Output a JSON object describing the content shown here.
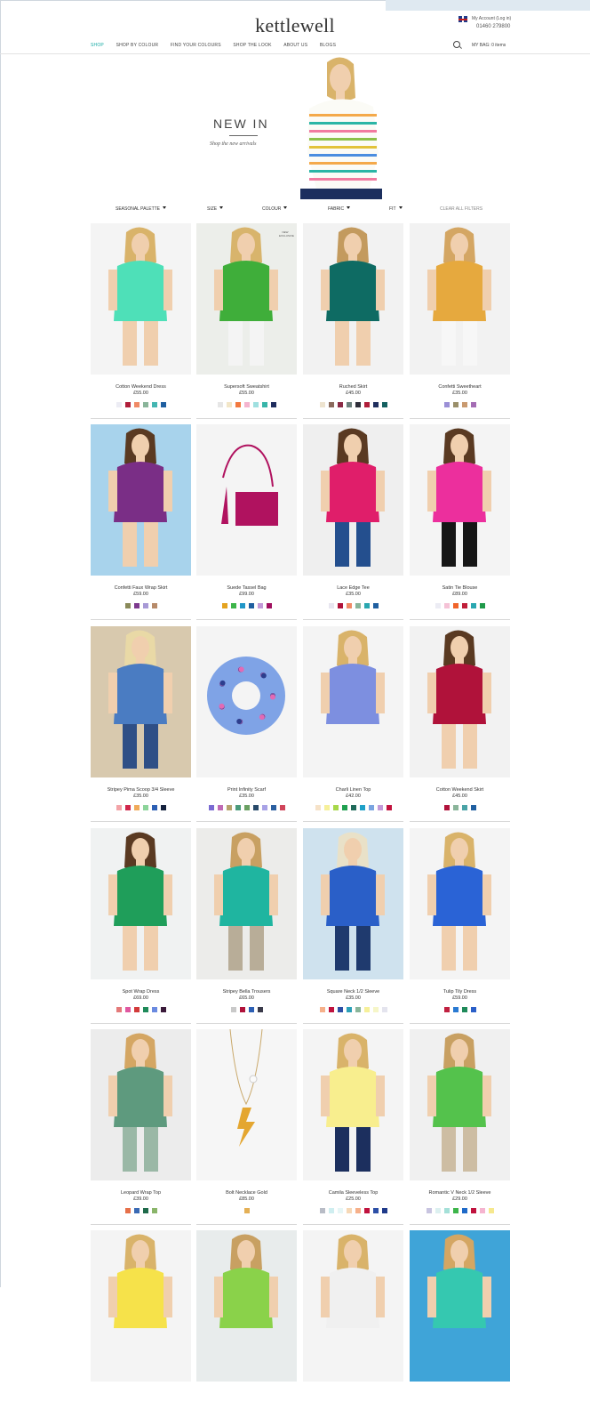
{
  "brand": {
    "logo": "kettlewell"
  },
  "account": {
    "login_text": "My Account (Log in)",
    "phone": "01460 279800"
  },
  "nav": {
    "items": [
      "SHOP",
      "SHOP BY COLOUR",
      "FIND YOUR COLOURS",
      "SHOP THE LOOK",
      "ABOUT US",
      "BLOGS"
    ],
    "bag": "MY BAG: 0 items"
  },
  "hero": {
    "title": "NEW IN",
    "subtitle": "Shop the new arrivals"
  },
  "filters": {
    "items": [
      "SEASONAL PALETTE",
      "SIZE",
      "COLOUR",
      "FABRIC",
      "FIT"
    ],
    "clear": "CLEAR ALL FILTERS"
  },
  "badge": "NEW EXCLUSIVE",
  "products": [
    {
      "name": "Cotton Weekend Dress",
      "price": "£55.00",
      "bg": "#f4f4f4",
      "main": "#4ee0b8",
      "skin": "#f0cfae",
      "hair": "#d9b36a",
      "legs": "#f0cfae",
      "swatches": [
        "#ececf4",
        "#b01e3a",
        "#f08a66",
        "#8ab59a",
        "#45b6b2",
        "#1f5fa0"
      ]
    },
    {
      "name": "Supersoft Sweatshirt",
      "price": "£55.00",
      "bg": "#eceeea",
      "main": "#3fae3a",
      "skin": "#f0cfae",
      "hair": "#d8b46c",
      "legs": "#f4f4f4",
      "swatches": [
        "#e6e6e6",
        "#f2e6c8",
        "#f2793f",
        "#f5b4cf",
        "#9fe0e0",
        "#38b5a9",
        "#1f2d5e"
      ]
    },
    {
      "name": "Ruched Skirt",
      "price": "£45.00",
      "bg": "#f2f2f2",
      "main": "#0e6b63",
      "skin": "#f0cfae",
      "hair": "#c39a5e",
      "legs": "#f0cfae",
      "swatches": [
        "#ede3cf",
        "#8a6a5c",
        "#8a2a45",
        "#6b7f7b",
        "#2f2f3a",
        "#b01e3a",
        "#1f2f5e",
        "#146060"
      ]
    },
    {
      "name": "Confetti Sweetheart",
      "price": "£35.00",
      "bg": "#f2f2f2",
      "main": "#e6a93e",
      "skin": "#f0cfae",
      "hair": "#d4a663",
      "legs": "#f7f7f7",
      "swatches": [
        "#9b8fd6",
        "#9a8f6a",
        "#c99a70",
        "#a46cb4"
      ]
    },
    {
      "name": "Confetti Faux Wrap Skirt",
      "price": "£59.00",
      "bg": "#a8d3ec",
      "main": "#7a2e86",
      "skin": "#f0cfae",
      "hair": "#5a3a22",
      "legs": "#f0cfae",
      "swatches": [
        "#8a8a5a",
        "#7d3a8e",
        "#a89ad6",
        "#b78b6a"
      ]
    },
    {
      "name": "Suede Tassel Bag",
      "price": "£99.00",
      "bg": "#f4f4f4",
      "main": "#b0125f",
      "skin": "#f4f4f4",
      "hair": "#f4f4f4",
      "legs": "#f4f4f4",
      "swatches": [
        "#e4a31f",
        "#3db54a",
        "#2096c8",
        "#1f5fa0",
        "#c39ad8",
        "#a01060"
      ]
    },
    {
      "name": "Lace Edge Tee",
      "price": "£35.00",
      "bg": "#efefef",
      "main": "#e01e6a",
      "skin": "#f0cfae",
      "hair": "#5a3a22",
      "legs": "#244f8e",
      "swatches": [
        "#e8e6f0",
        "#b0123a",
        "#f08a66",
        "#8ab59a",
        "#2aa7b0",
        "#1f5fa0"
      ]
    },
    {
      "name": "Satin Tie Blouse",
      "price": "£89.00",
      "bg": "#f4f4f4",
      "main": "#ec2f9d",
      "skin": "#f0cfae",
      "hair": "#5a3a22",
      "legs": "#161616",
      "swatches": [
        "#ececf4",
        "#f5c2d6",
        "#f0642a",
        "#c01e3a",
        "#2aa7b0",
        "#1f9a4a"
      ]
    },
    {
      "name": "Stripey Pima Scoop 3/4 Sleeve",
      "price": "£35.00",
      "bg": "#d8c9ae",
      "main": "#4a7cc2",
      "skin": "#f0cfae",
      "hair": "#e9d9a6",
      "legs": "#2f4f86",
      "swatches": [
        "#f3a4a8",
        "#d0264b",
        "#f0aa5a",
        "#8cd49a",
        "#2c5fb4",
        "#14213d"
      ]
    },
    {
      "name": "Print Infinity Scarf",
      "price": "£35.00",
      "bg": "#f4f4f4",
      "main": "#7fa3e6",
      "skin": "#f4f4f4",
      "hair": "#f4f4f4",
      "legs": "#f4f4f4",
      "swatches": [
        "#7a6ad2",
        "#c06ab4",
        "#b7a36e",
        "#4a9a7a",
        "#6aa062",
        "#284a6a",
        "#a8a2e6",
        "#2b5fa0",
        "#d0445a"
      ]
    },
    {
      "name": "Charli Linen Top",
      "price": "£42.00",
      "bg": "#f4f4f4",
      "main": "#7d8fe0",
      "skin": "#f0cfae",
      "hair": "#d9b36a",
      "legs": "#f4f4f4",
      "swatches": [
        "#f6e2c8",
        "#f6f09a",
        "#a7d84a",
        "#20a050",
        "#1f6a5a",
        "#1ea0c8",
        "#7aa4e0",
        "#c39ad8",
        "#c2123e"
      ]
    },
    {
      "name": "Cotton Weekend Skirt",
      "price": "£45.00",
      "bg": "#f2f2f2",
      "main": "#b0123a",
      "skin": "#f0cfae",
      "hair": "#5a3a22",
      "legs": "#f0cfae",
      "swatches": [
        "#b0123a",
        "#8ab59a",
        "#4aa3a6",
        "#1f5fa0"
      ]
    },
    {
      "name": "Spot Wrap Dress",
      "price": "£69.00",
      "bg": "#f0f2f2",
      "main": "#1f9e5a",
      "skin": "#f0cfae",
      "hair": "#5a3a22",
      "legs": "#f0cfae",
      "swatches": [
        "#e47a7a",
        "#e058a0",
        "#d23a3a",
        "#1f8a5a",
        "#6a8ae0",
        "#3a1a3a"
      ]
    },
    {
      "name": "Stripey Bella Trousers",
      "price": "£65.00",
      "bg": "#ececea",
      "main": "#1fb5a0",
      "skin": "#f0cfae",
      "hair": "#c8a062",
      "legs": "#b8ad98",
      "swatches": [
        "#c9c9c9",
        "#b0123a",
        "#2c5fb4",
        "#3a3a4a"
      ]
    },
    {
      "name": "Square Neck 1/2 Sleeve",
      "price": "£35.00",
      "bg": "#cfe2ee",
      "main": "#2a5fc8",
      "skin": "#f0cfae",
      "hair": "#e9e1c8",
      "legs": "#1f3a6e",
      "swatches": [
        "#f6b08a",
        "#c0123e",
        "#2c4fa6",
        "#2ca0b8",
        "#8ab59a",
        "#f6f09a",
        "#f6f6c8",
        "#e4e4ee"
      ]
    },
    {
      "name": "Tulip Tily Dress",
      "price": "£59.00",
      "bg": "#f4f4f4",
      "main": "#2a63d6",
      "skin": "#f0cfae",
      "hair": "#d9b36a",
      "legs": "#f0cfae",
      "swatches": [
        "#c02040",
        "#2a7ad2",
        "#1f8a5a",
        "#2a5fc8"
      ]
    },
    {
      "name": "Leopard Wrap Top",
      "price": "£39.00",
      "bg": "#ececec",
      "main": "#5e9a7e",
      "skin": "#f0cfae",
      "hair": "#d4a663",
      "legs": "#9ab8a6",
      "swatches": [
        "#e6704a",
        "#3a6ab4",
        "#1f6a4a",
        "#8ab56a"
      ]
    },
    {
      "name": "Bolt Necklace Gold",
      "price": "£85.00",
      "bg": "#f6f6f6",
      "main": "#e4a630",
      "skin": "#f6f6f6",
      "hair": "#f6f6f6",
      "legs": "#f6f6f6",
      "swatches": [
        "#e4b056"
      ]
    },
    {
      "name": "Camila Sleeveless Top",
      "price": "£25.00",
      "bg": "#f4f4f4",
      "main": "#f8ee8e",
      "skin": "#f0cfae",
      "hair": "#d9b36a",
      "legs": "#1c2f5e",
      "swatches": [
        "#b8bcc6",
        "#cfeef0",
        "#e6f6f6",
        "#f6d8b6",
        "#f6b08a",
        "#c0123e",
        "#2c4fa6",
        "#1f3a8a"
      ]
    },
    {
      "name": "Romantic V Neck 1/2 Sleeve",
      "price": "£29.00",
      "bg": "#f0f0f0",
      "main": "#54c24c",
      "skin": "#f0cfae",
      "hair": "#c8a062",
      "legs": "#cdbda3",
      "swatches": [
        "#c8c4e0",
        "#dcf0f0",
        "#a4e0d8",
        "#3db54a",
        "#1f6ac8",
        "#c0123e",
        "#f5b4cf",
        "#f6e88e"
      ]
    },
    {
      "name": "",
      "price": "",
      "bg": "#f4f4f4",
      "main": "#f6e24a",
      "skin": "#f0cfae",
      "hair": "#d9b36a",
      "legs": "#f4f4f4",
      "swatches": []
    },
    {
      "name": "",
      "price": "",
      "bg": "#e8ecec",
      "main": "#8ad24a",
      "skin": "#f0cfae",
      "hair": "#c8a062",
      "legs": "#e8ecec",
      "swatches": []
    },
    {
      "name": "",
      "price": "",
      "bg": "#f4f4f4",
      "main": "#f0f0f0",
      "skin": "#f0cfae",
      "hair": "#d9b36a",
      "legs": "#f4f4f4",
      "swatches": []
    },
    {
      "name": "",
      "price": "",
      "bg": "#3fa4d8",
      "main": "#35c8b0",
      "skin": "#f0cfae",
      "hair": "#d4a663",
      "legs": "#3fa4d8",
      "swatches": []
    }
  ]
}
